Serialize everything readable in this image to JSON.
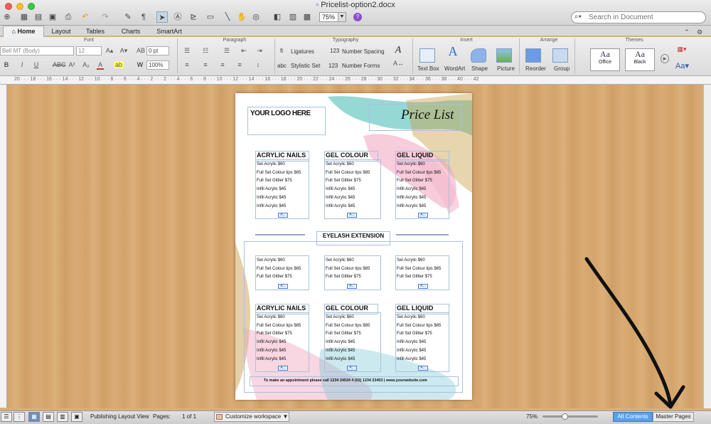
{
  "window": {
    "title": "Pricelist-option2.docx"
  },
  "toolbar": {
    "zoom": "75%",
    "search_placeholder": "Search in Document"
  },
  "tabs": [
    "Home",
    "Layout",
    "Tables",
    "Charts",
    "SmartArt"
  ],
  "ribbon": {
    "groups": {
      "font": "Font",
      "paragraph": "Paragraph",
      "typography": "Typography",
      "insert": "Insert",
      "arrange": "Arrange",
      "themes": "Themes"
    },
    "font_name": "Bell MT (Body)",
    "font_size": "12",
    "spacing": "0 pt",
    "scale": "100%",
    "ligatures": "Ligatures",
    "number_spacing": "Number Spacing",
    "stylistic_set": "Stylistic Set",
    "number_forms": "Number Forms",
    "insert_items": [
      "Text Box",
      "WordArt",
      "Shape",
      "Picture"
    ],
    "arrange_items": [
      "Reorder",
      "Group"
    ],
    "themes": [
      "Office",
      "Black"
    ]
  },
  "ruler_numbers": "20 · · · 18 · · · 16 · · · 14 · · · 12 · · · 10 · · · 8 · · · 6 · · · 4 · · · 2 · · · 2 · · · 4 · · · 6 · · · 8 · · · 10 · · · 12 · · · 14 · · · 16 · · · 18 · · · 20 · · · 22 · · · 24 · · · 26 · · · 28 · · · 30 · · · 32 · · · 34 · · · 36 · · · 38 · · · 40 · · · 42",
  "page": {
    "logo": "YOUR LOGO HERE",
    "title": "Price List",
    "top_columns": [
      {
        "heading": "ACRYLIC NAILS",
        "items": [
          "Set Acrylic  $60",
          "Full Set Colour tips $65",
          "Full Set Glitter $75",
          "Infill Acrylic $45",
          "Infill Acrylic $45",
          "Infill Acrylic $45"
        ]
      },
      {
        "heading": "GEL COLOUR",
        "items": [
          "Set Acrylic  $60",
          "Full Set Colour tips $65",
          "Full Set Glitter $75",
          "Infill Acrylic $45",
          "Infill Acrylic $45",
          "Infill Acrylic $45"
        ]
      },
      {
        "heading": "GEL LIQUID",
        "items": [
          "Set Acrylic  $60",
          "Full Set Colour tips $65",
          "Full Set Glitter $75",
          "Infill Acrylic $45",
          "Infill Acrylic $45",
          "Infill Acrylic $45"
        ]
      }
    ],
    "section": "EYELASH EXTENSION",
    "mid_columns": [
      {
        "items": [
          "Set Acrylic  $60",
          "Full Set Colour tips $65",
          "Full Set Glitter $75"
        ]
      },
      {
        "items": [
          "Set Acrylic  $60",
          "Full Set Colour tips $65",
          "Full Set Glitter $75"
        ]
      },
      {
        "items": [
          "Set Acrylic  $60",
          "Full Set Colour tips $65",
          "Full Set Glitter $75"
        ]
      }
    ],
    "bottom_columns": [
      {
        "heading": "ACRYLIC NAILS",
        "items": [
          "Set Acrylic  $60",
          "Full Set Colour tips $65",
          "Full Set Glitter $75",
          "Infill Acrylic $45",
          "Infill Acrylic $45",
          "Infill Acrylic $45"
        ]
      },
      {
        "heading": "GEL COLOUR",
        "items": [
          "Set Acrylic  $60",
          "Full Set Colour tips $65",
          "Full Set Glitter $75",
          "Infill Acrylic $45",
          "Infill Acrylic $45",
          "Infill Acrylic $45"
        ]
      },
      {
        "heading": "GEL LIQUID",
        "items": [
          "Set Acrylic  $60",
          "Full Set Colour tips $65",
          "Full Set Glitter $75",
          "Infill Acrylic $45",
          "Infill Acrylic $45",
          "Infill Acrylic $45"
        ]
      }
    ],
    "footer": "To make an appointment please call  1234 24534 4 (02) 1234 23453 | www.yourwebsite.com",
    "anchor_label": "A..."
  },
  "statusbar": {
    "view_name": "Publishing Layout View",
    "pages_label": "Pages:",
    "pages_value": "1 of 1",
    "customize": "Customize workspace",
    "zoom": "75%",
    "all_contents": "All Contents",
    "master_pages": "Master Pages"
  },
  "colors": {
    "teal": "#3fb8b0",
    "pink": "#f0a3be",
    "gold": "#c9a24a",
    "selection_blue": "#5aa0e6"
  }
}
